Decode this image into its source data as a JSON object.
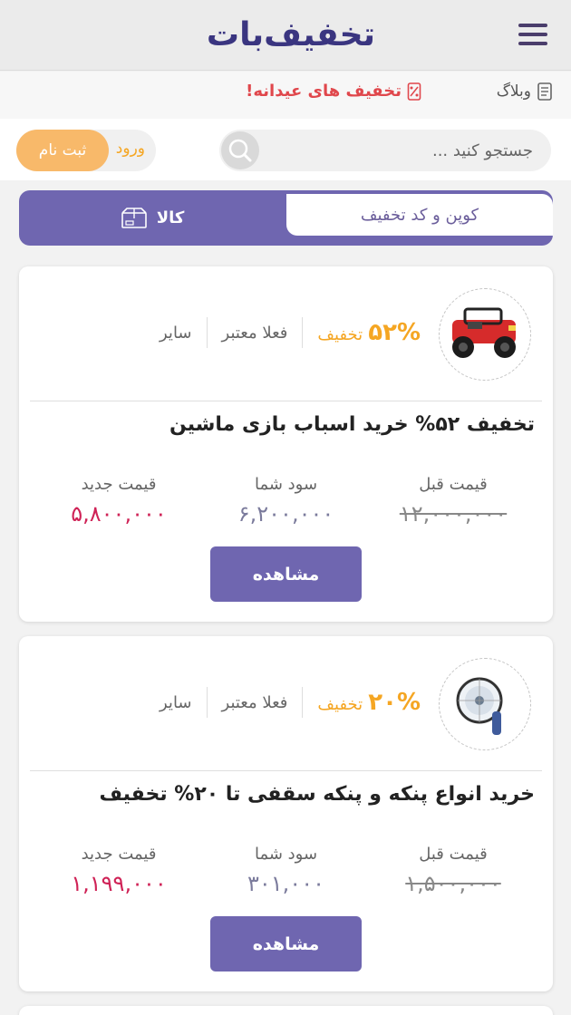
{
  "header": {
    "logo_text": "تخفیف‌بات",
    "menu_icon": "hamburger-icon",
    "brand_color": "#3a3580",
    "accent_color": "#f5a623"
  },
  "subnav": {
    "blog_label": "وبلاگ",
    "promo_label": "تخفیف های عیدانه!"
  },
  "search": {
    "placeholder": "جستجو کنید ..."
  },
  "auth": {
    "login_label": "ورود",
    "register_label": "ثبت نام"
  },
  "tabs": {
    "products_label": "کالا",
    "coupons_label": "کوپن و کد تخفیف"
  },
  "deals": [
    {
      "discount_pct": "۵۲%",
      "discount_label": "تخفیف",
      "status": "فعلا معتبر",
      "category": "سایر",
      "title": "تخفیف ۵۲% خرید اسباب بازی ماشین",
      "old_price_label": "قیمت قبل",
      "old_price": "۱۲,۰۰۰,۰۰۰",
      "savings_label": "سود شما",
      "savings": "۶,۲۰۰,۰۰۰",
      "new_price_label": "قیمت جدید",
      "new_price": "۵,۸۰۰,۰۰۰",
      "view_label": "مشاهده"
    },
    {
      "discount_pct": "۲۰%",
      "discount_label": "تخفیف",
      "status": "فعلا معتبر",
      "category": "سایر",
      "title": "خرید انواع پنکه و پنکه سقفی تا ۲۰% تخفیف",
      "old_price_label": "قیمت قبل",
      "old_price": "۱,۵۰۰,۰۰۰",
      "savings_label": "سود شما",
      "savings": "۳۰۱,۰۰۰",
      "new_price_label": "قیمت جدید",
      "new_price": "۱,۱۹۹,۰۰۰",
      "view_label": "مشاهده"
    }
  ]
}
